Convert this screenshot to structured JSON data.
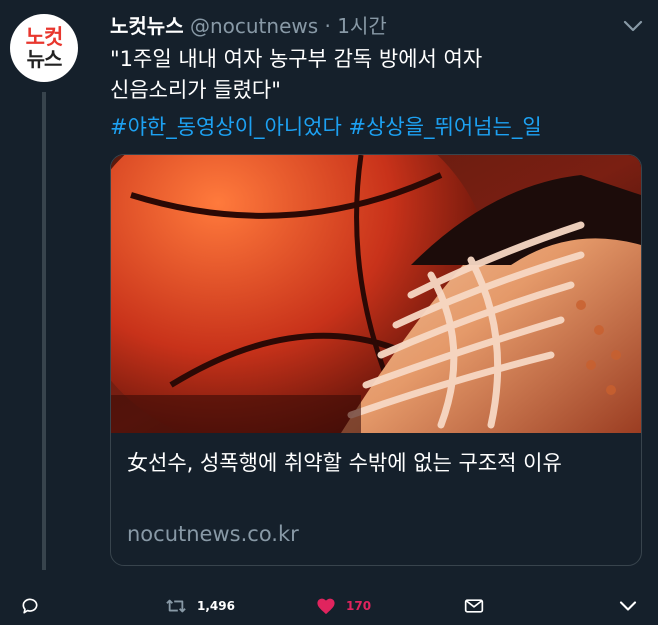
{
  "author": {
    "avatar_line1": "노컷",
    "avatar_line2": "뉴스",
    "name": "노컷뉴스",
    "handle": "@nocutnews",
    "separator": "·",
    "time": "1시간"
  },
  "tweet": {
    "line1": "\"1주일 내내 여자 농구부 감독 방에서 여자",
    "line2": "신음소리가 들렸다\"",
    "hashtags": [
      "#야한_동영상이_아니었다",
      "#상상을_뛰어넘는_일"
    ]
  },
  "card": {
    "title": "女선수, 성폭행에 취약할 수밖에 없는 구조적 이유",
    "domain": "nocutnews.co.kr"
  },
  "actions": {
    "retweet_count": "1,496",
    "like_count": "170"
  },
  "colors": {
    "background": "#15202b",
    "secondary_text": "#8899a6",
    "link": "#1da1f2",
    "like": "#e0245e",
    "border": "#38444d"
  },
  "icons": {
    "reply": "reply-icon",
    "retweet": "retweet-icon",
    "like": "heart-icon",
    "dm": "mail-icon",
    "more": "chevron-down-icon"
  }
}
